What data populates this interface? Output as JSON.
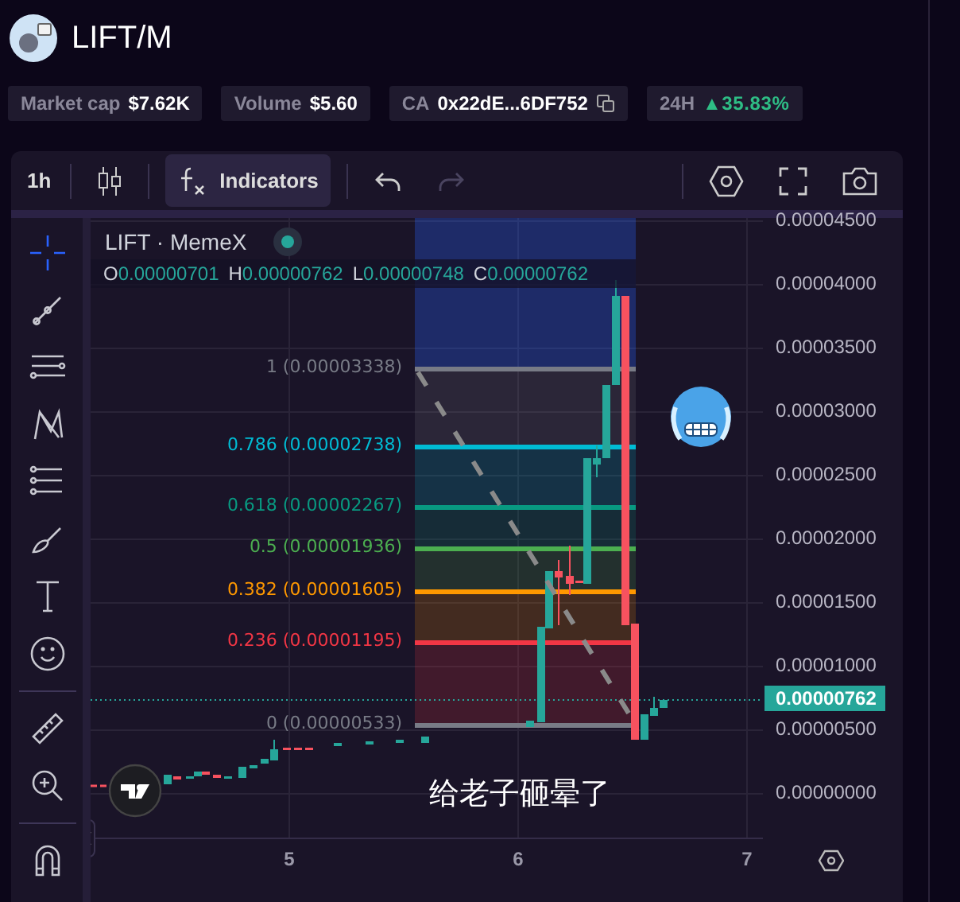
{
  "header": {
    "title": "LIFT/M"
  },
  "stats": [
    {
      "kind": "plain",
      "label": "Market cap",
      "value": "$7.62K"
    },
    {
      "kind": "plain",
      "label": "Volume",
      "value": "$5.60"
    },
    {
      "kind": "copy",
      "label": "CA",
      "value": "0x22dE...6DF752"
    },
    {
      "kind": "change",
      "label": "24H",
      "value": "▲35.83%"
    }
  ],
  "toolbar": {
    "interval": "1h",
    "indicators": "Indicators",
    "redo_disabled": true
  },
  "tools": [
    {
      "kind": "crosshair",
      "selected": true
    },
    {
      "kind": "trendline",
      "selected": false
    },
    {
      "kind": "lines",
      "selected": false
    },
    {
      "kind": "pattern",
      "selected": false
    },
    {
      "kind": "fib",
      "selected": false
    },
    {
      "kind": "brush",
      "selected": false
    },
    {
      "kind": "text",
      "selected": false
    },
    {
      "kind": "emoji",
      "selected": false
    },
    {
      "kind": "ruler",
      "selected": false
    },
    {
      "kind": "zoom",
      "selected": false
    },
    {
      "kind": "magnet",
      "selected": false
    }
  ],
  "legend": {
    "title": "LIFT · MemeX",
    "ohlc": [
      {
        "label": "O",
        "value": "0.00000701"
      },
      {
        "label": "H",
        "value": "0.00000762"
      },
      {
        "label": "L",
        "value": "0.00000748"
      },
      {
        "label": "C",
        "value": "0.00000762"
      }
    ]
  },
  "fib_levels": [
    {
      "label": "1 (0.00003338)",
      "color": "#787b86"
    },
    {
      "label": "0.786 (0.00002738)",
      "color": "#00bcd4"
    },
    {
      "label": "0.618 (0.00002267)",
      "color": "#089981"
    },
    {
      "label": "0.5 (0.00001936)",
      "color": "#4caf50"
    },
    {
      "label": "0.382 (0.00001605)",
      "color": "#ff9800"
    },
    {
      "label": "0.236 (0.00001195)",
      "color": "#f23645"
    },
    {
      "label": "0 (0.00000533)",
      "color": "#787b86"
    }
  ],
  "caption": "给老子砸晕了",
  "price_axis": [
    "0.00004500",
    "0.00004000",
    "0.00003500",
    "0.00003000",
    "0.00002500",
    "0.00002000",
    "0.00001500",
    "0.00001000",
    "0.00000500",
    "0.00000000"
  ],
  "last_price": "0.00000762",
  "time_axis": [
    "5",
    "6",
    "7"
  ]
}
